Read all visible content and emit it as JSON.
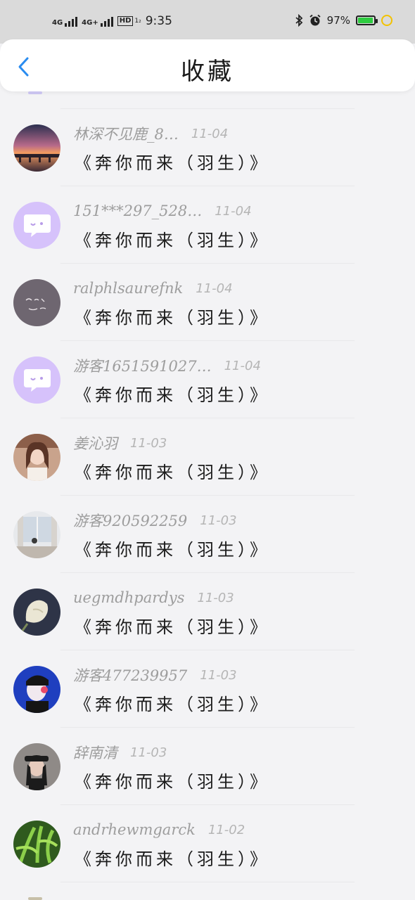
{
  "status_bar": {
    "net1": "4G",
    "net2": "4G+",
    "hd": "HD",
    "hd_sub": "1₂",
    "time": "9:35",
    "bluetooth_icon": "bluetooth-icon",
    "alarm_icon": "alarm-icon",
    "battery_percent": "97%",
    "battery_level": 0.97,
    "battery_color": "#2ecc40"
  },
  "header": {
    "title": "收藏",
    "back_icon": "chevron-left-icon",
    "accent": "#2a8cf0"
  },
  "items": [
    {
      "name": "林深不见鹿_8…",
      "date": "11-04",
      "song": "《奔你而来（羽生）》",
      "avatar": "sunset-bridge-photo"
    },
    {
      "name": "151***297_528…",
      "date": "11-04",
      "song": "《奔你而来（羽生）》",
      "avatar": "default-chat-bubble"
    },
    {
      "name": "ralphlsaurefnk",
      "date": "11-04",
      "song": "《奔你而来（羽生）》",
      "avatar": "handwritten-grey-photo"
    },
    {
      "name": "游客1651591027…",
      "date": "11-04",
      "song": "《奔你而来（羽生）》",
      "avatar": "default-chat-bubble"
    },
    {
      "name": "姜沁羽",
      "date": "11-03",
      "song": "《奔你而来（羽生）》",
      "avatar": "girl-portrait-photo"
    },
    {
      "name": "游客920592259",
      "date": "11-03",
      "song": "《奔你而来（羽生）》",
      "avatar": "window-room-photo"
    },
    {
      "name": "uegmdhpardys",
      "date": "11-03",
      "song": "《奔你而来（羽生）》",
      "avatar": "white-flower-photo"
    },
    {
      "name": "游客477239957",
      "date": "11-03",
      "song": "《奔你而来（羽生）》",
      "avatar": "anime-boy-photo"
    },
    {
      "name": "辞南清",
      "date": "11-03",
      "song": "《奔你而来（羽生）》",
      "avatar": "cap-girl-photo"
    },
    {
      "name": "andrhewmgarck",
      "date": "11-02",
      "song": "《奔你而来（羽生）》",
      "avatar": "green-plant-photo"
    }
  ],
  "colors": {
    "name_text": "#9d9d9d",
    "date_text": "#b5b5b5",
    "song_text": "#1c1c1c",
    "default_avatar": "#d6c2fb"
  }
}
